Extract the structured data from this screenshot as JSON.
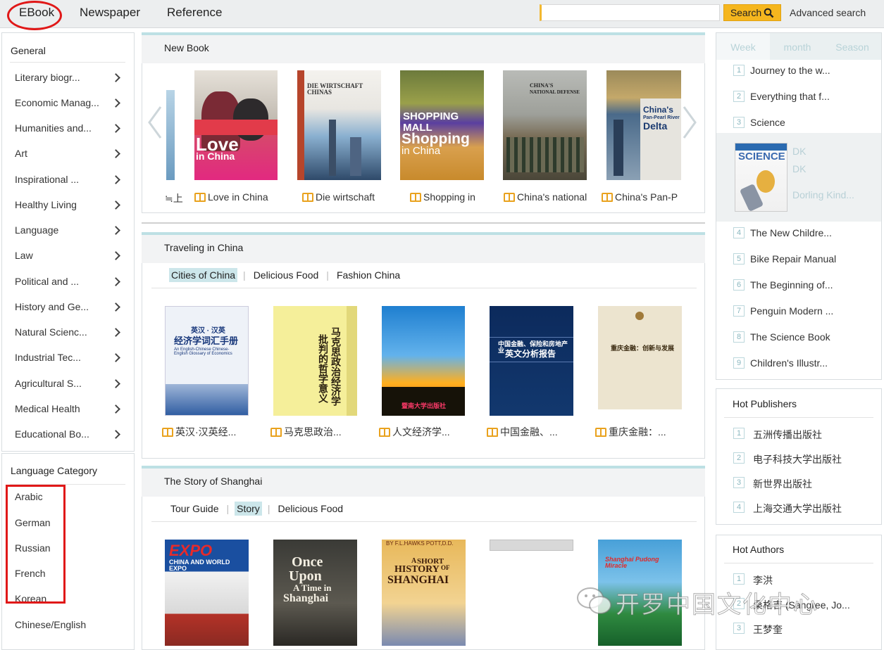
{
  "topnav": {
    "items": [
      "EBook",
      "Newspaper",
      "Reference"
    ],
    "search_placeholder": "",
    "search_label": "Search",
    "advanced_search": "Advanced search"
  },
  "sidebar": {
    "general_title": "General",
    "categories": [
      "Literary biogr...",
      "Economic Manag...",
      "Humanities and...",
      "Art",
      "Inspirational ...",
      "Healthy Living",
      "Language",
      "Law",
      "Political and ...",
      "History and Ge...",
      "Natural Scienc...",
      "Industrial Tec...",
      "Agricultural S...",
      "Medical Health",
      "Educational Bo..."
    ],
    "language_title": "Language Category",
    "languages": [
      "Arabic",
      "German",
      "Russian",
      "French",
      "Korean",
      "Chinese/English"
    ]
  },
  "new_book": {
    "title": "New Book",
    "partial_title": "≒上",
    "books": [
      "Love in China",
      "Die wirtschaft",
      "Shopping in",
      "China's national",
      "China's Pan-P"
    ],
    "covers": {
      "love": [
        "Love",
        "in China"
      ],
      "die": [
        "DIE WIRTSCHAFT CHINAS"
      ],
      "shop": [
        "SHOPPING MALL",
        "Shopping",
        "in China"
      ],
      "defense": [
        "CHINA'S",
        "NATIONAL DEFENSE"
      ],
      "delta": [
        "China's",
        "Pan-Pearl River",
        "Delta"
      ]
    }
  },
  "traveling": {
    "title": "Traveling in China",
    "tabs": [
      "Cities of China",
      "Delicious Food",
      "Fashion China"
    ],
    "books": [
      "英汉·汉英经...",
      "马克思政治...",
      "人文经济学...",
      "中国金融、...",
      "重庆金融：..."
    ],
    "covers": {
      "b1": [
        "英汉 · 汉英",
        "经济学词汇手册",
        "An English-Chinese Chinese-English Glossary of Economics"
      ],
      "b2": [
        "马克思政治经济学",
        "批判的哲学意义"
      ],
      "b3": [
        "暨南大学出版社"
      ],
      "b4": [
        "中国金融、保险和房地产业",
        "英文分析报告"
      ],
      "b5": [
        "重庆金融：创新与发展"
      ]
    }
  },
  "shanghai": {
    "title": "The Story of Shanghai",
    "tabs": [
      "Tour Guide",
      "Story",
      "Delicious Food"
    ],
    "covers": {
      "expo": [
        "EXPO",
        "CHINA AND WORLD EXPO"
      ],
      "once": [
        "Once",
        "Upon",
        "A Time in",
        "Shanghai"
      ],
      "short": [
        "BY F.L.HAWKS POTT,D.D.",
        "A",
        "SHORT",
        "HISTORY",
        "OF",
        "SHANGHAI"
      ],
      "pudong": [
        "Shanghai Pudong Miracle"
      ]
    }
  },
  "ranking": {
    "tabs": [
      "Week",
      "month",
      "Season"
    ],
    "items": [
      "Journey to the w...",
      "Everything that f...",
      "Science",
      "The New Childre...",
      "Bike Repair Manual",
      "The Beginning of...",
      "Penguin Modern ...",
      "The Science Book",
      "Children's Illustr..."
    ],
    "feature": {
      "cover_label": "SCIENCE",
      "lines": [
        "DK",
        "DK",
        "Dorling Kind..."
      ]
    }
  },
  "publishers": {
    "title": "Hot Publishers",
    "items": [
      "五洲传播出版社",
      "电子科技大学出版社",
      "新世界出版社",
      "上海交通大学出版社"
    ]
  },
  "authors": {
    "title": "Hot Authors",
    "items": [
      "李洪",
      "桑格吉 (Sangree, Jo...",
      "王梦奎"
    ]
  },
  "watermark": "开罗中国文化中心",
  "colors": {
    "accent": "#f5b61e",
    "highlight": "#e01818",
    "tab_active": "#cce6ea",
    "section_border": "#bde0e4"
  }
}
